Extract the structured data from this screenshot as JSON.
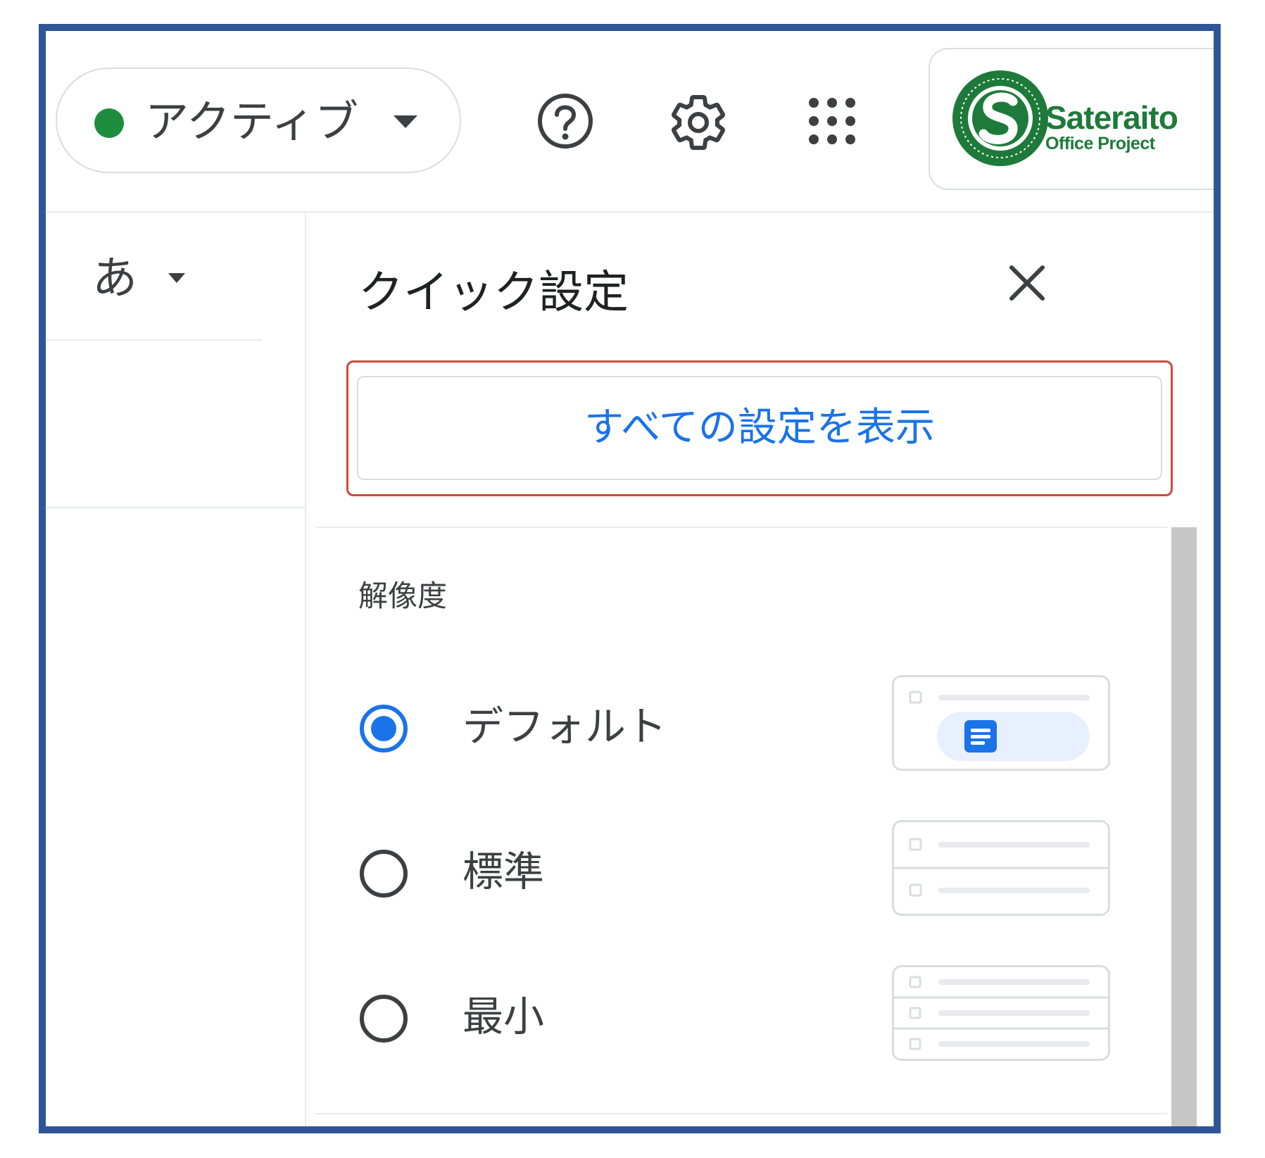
{
  "header": {
    "status": {
      "label": "アクティブ",
      "dot_color": "#1e8e3e"
    },
    "icons": [
      "help-icon",
      "gear-icon",
      "apps-grid-icon"
    ]
  },
  "left": {
    "ime_label": "あ"
  },
  "quick_settings": {
    "title": "クイック設定",
    "close_icon": "close-icon",
    "all_settings_button": "すべての設定を表示",
    "highlight_color": "#cc4a3c",
    "density": {
      "label": "解像度",
      "selected": "デフォルト",
      "options": [
        {
          "label": "デフォルト",
          "selected": true
        },
        {
          "label": "標準",
          "selected": false
        },
        {
          "label": "最小",
          "selected": false
        }
      ]
    }
  },
  "colors": {
    "accent": "#1a73e8",
    "frame": "#2f5597",
    "logo_green": "#1e7a3a"
  }
}
